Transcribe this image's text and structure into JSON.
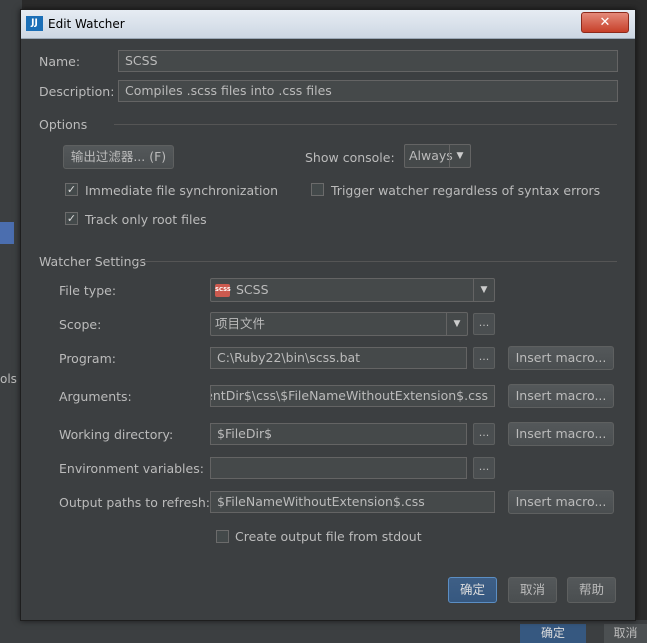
{
  "background": {
    "side_text": "ols",
    "bottom_ok": "确定",
    "bottom_cancel": "取消"
  },
  "dialog": {
    "title": "Edit Watcher",
    "app_icon_text": "JJ",
    "close_glyph": "✕",
    "name": {
      "label": "Name:",
      "value": "SCSS"
    },
    "description": {
      "label": "Description:",
      "value": "Compiles .scss files into .css files"
    },
    "options": {
      "header": "Options",
      "filter_button": "输出过滤器... (F)",
      "show_console_label": "Show console:",
      "show_console_value": "Always",
      "immediate_sync": {
        "label": "Immediate file synchronization",
        "checked": true
      },
      "trigger_regardless": {
        "label": "Trigger watcher regardless of syntax errors",
        "checked": false
      },
      "track_root": {
        "label": "Track only root files",
        "checked": true
      }
    },
    "watcher_settings": {
      "header": "Watcher Settings",
      "file_type": {
        "label": "File type:",
        "value": "SCSS",
        "icon_text": "SCSS"
      },
      "scope": {
        "label": "Scope:",
        "value": "项目文件"
      },
      "program": {
        "label": "Program:",
        "value": "C:\\Ruby22\\bin\\scss.bat"
      },
      "arguments": {
        "label": "Arguments:",
        "value": "arentDir$\\css\\$FileNameWithoutExtension$.css"
      },
      "working_directory": {
        "label": "Working directory:",
        "value": "$FileDir$"
      },
      "environment_variables": {
        "label": "Environment variables:",
        "value": ""
      },
      "output_paths": {
        "label": "Output paths to refresh:",
        "value": "$FileNameWithoutExtension$.css"
      },
      "create_output": {
        "label": "Create output file from stdout",
        "checked": false
      },
      "browse_label": "...",
      "insert_macro": "Insert macro..."
    },
    "footer": {
      "ok": "确定",
      "cancel": "取消",
      "help": "帮助"
    }
  }
}
